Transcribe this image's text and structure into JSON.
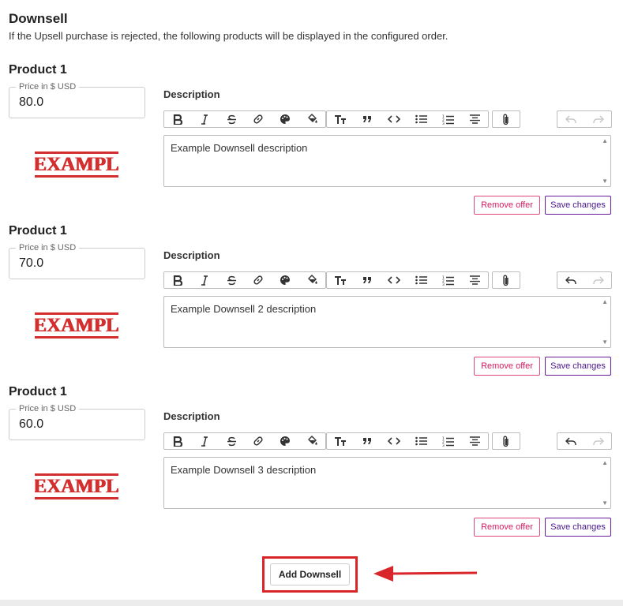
{
  "header": {
    "title": "Downsell",
    "description": "If the Upsell purchase is rejected, the following products will be displayed in the configured order."
  },
  "products": [
    {
      "title": "Product 1",
      "price_label": "Price in $ USD",
      "price": "80.0",
      "image_text": "EXAMPLE",
      "description_label": "Description",
      "description": "Example Downsell description",
      "redo_disabled": true,
      "undo_disabled": true
    },
    {
      "title": "Product 1",
      "price_label": "Price in $ USD",
      "price": "70.0",
      "image_text": "EXAMPLE",
      "description_label": "Description",
      "description": "Example Downsell 2 description",
      "redo_disabled": true,
      "undo_disabled": false
    },
    {
      "title": "Product 1",
      "price_label": "Price in $ USD",
      "price": "60.0",
      "image_text": "EXAMPLE",
      "description_label": "Description",
      "description": "Example Downsell 3 description",
      "redo_disabled": true,
      "undo_disabled": false
    }
  ],
  "buttons": {
    "remove": "Remove offer",
    "save": "Save changes",
    "add": "Add Downsell"
  },
  "colors": {
    "remove_accent": "#d81b60",
    "save_accent": "#4a148c",
    "highlight": "#d9262b"
  }
}
